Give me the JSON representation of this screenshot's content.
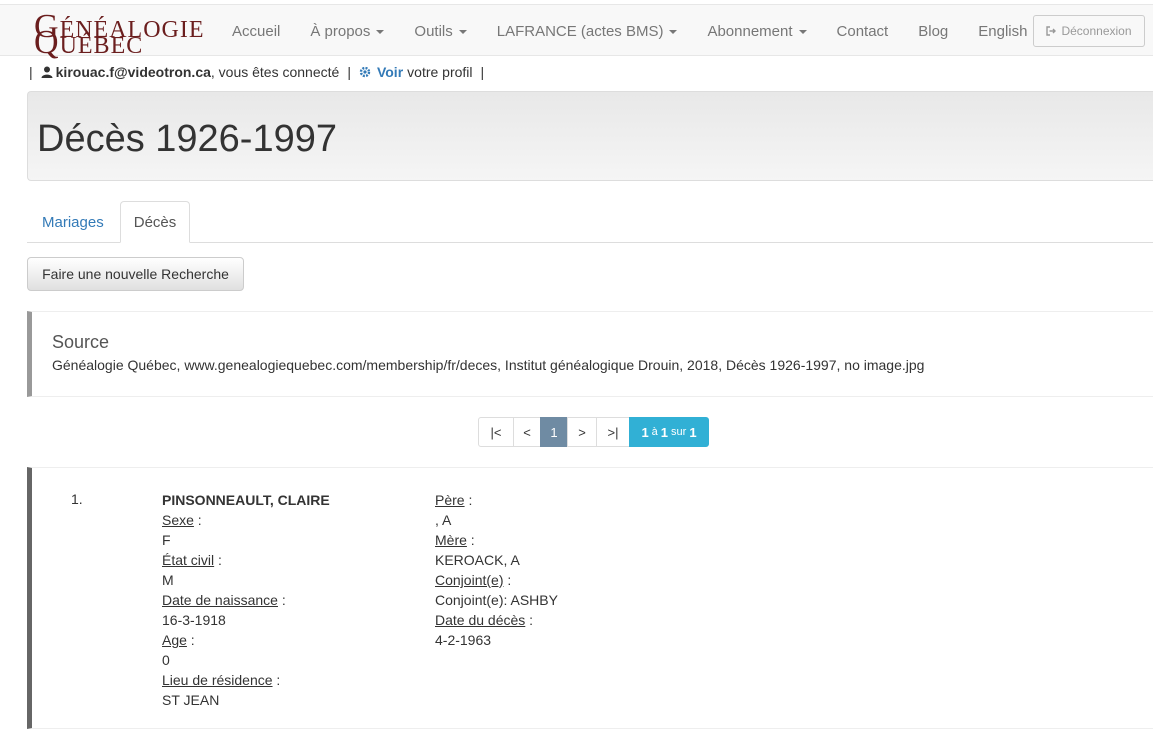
{
  "brand": {
    "line1_initial": "G",
    "line1_rest": "ÉNÉALOGIE",
    "line2_initial": "Q",
    "line2_rest": "UÉBEC",
    "color": "#6b1e1e"
  },
  "nav": {
    "items": [
      {
        "label": "Accueil",
        "dropdown": false
      },
      {
        "label": "À propos",
        "dropdown": true
      },
      {
        "label": "Outils",
        "dropdown": true
      },
      {
        "label": "LAFRANCE (actes BMS)",
        "dropdown": true
      },
      {
        "label": "Abonnement",
        "dropdown": true
      },
      {
        "label": "Contact",
        "dropdown": false
      },
      {
        "label": "Blog",
        "dropdown": false
      },
      {
        "label": "English",
        "dropdown": false
      }
    ],
    "logout_label": "Déconnexion"
  },
  "user": {
    "sep": "|",
    "email": "kirouac.f@videotron.ca",
    "connected_text": ", vous êtes connecté",
    "view_label": "Voir",
    "profile_text": "votre profil"
  },
  "page": {
    "title": "Décès 1926-1997"
  },
  "tabs": [
    {
      "label": "Mariages",
      "active": false
    },
    {
      "label": "Décès",
      "active": true
    }
  ],
  "new_search_label": "Faire une nouvelle Recherche",
  "source": {
    "heading": "Source",
    "text": "Généalogie Québec, www.genealogiequebec.com/membership/fr/deces, Institut généalogique Drouin, 2018, Décès 1926-1997, no image.jpg"
  },
  "pagination": {
    "first": "|<",
    "prev": "<",
    "current": "1",
    "next": ">",
    "last": ">|",
    "range_from": "1",
    "range_sep": "à",
    "range_to": "1",
    "of_word": "sur",
    "total": "1"
  },
  "record": {
    "number": "1.",
    "name": "PINSONNEAULT, CLAIRE",
    "sexe_label": "Sexe",
    "sexe": "F",
    "etat_label": "État civil",
    "etat": "M",
    "naissance_label": "Date de naissance",
    "naissance": "16-3-1918",
    "age_label": "Age",
    "age": "0",
    "residence_label": "Lieu de résidence",
    "residence": "ST JEAN",
    "pere_label": "Père",
    "pere": ", A",
    "mere_label": "Mère",
    "mere": "KEROACK, A",
    "conjoint_label": "Conjoint(e)",
    "conjoint": "Conjoint(e): ASHBY",
    "deces_label": "Date du décès",
    "deces": "4-2-1963",
    "colon": " :"
  }
}
